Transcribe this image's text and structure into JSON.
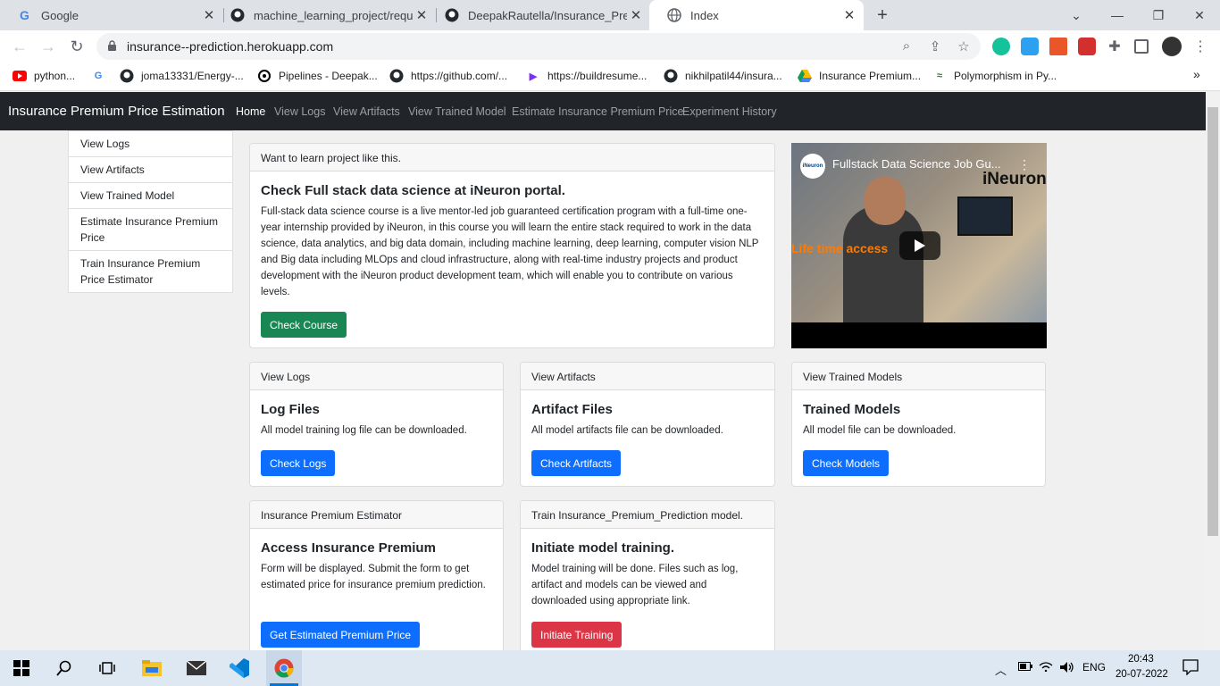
{
  "browser": {
    "tabs": [
      {
        "title": "Google",
        "icon": "google-g-icon",
        "active": false
      },
      {
        "title": "machine_learning_project/requir…",
        "icon": "github-icon",
        "active": false
      },
      {
        "title": "DeepakRautella/Insurance_Prem…",
        "icon": "github-icon",
        "active": false
      },
      {
        "title": "Index",
        "icon": "globe-icon",
        "active": true
      }
    ],
    "url": "insurance--prediction.herokuapp.com",
    "bookmarks": [
      {
        "label": "python...",
        "icon": "youtube-icon"
      },
      {
        "label": "",
        "icon": "google-g-icon"
      },
      {
        "label": "joma13331/Energy-...",
        "icon": "github-icon"
      },
      {
        "label": "Pipelines - Deepak...",
        "icon": "pipelines-icon"
      },
      {
        "label": "https://github.com/...",
        "icon": "github-icon"
      },
      {
        "label": "https://buildresume...",
        "icon": "play-icon"
      },
      {
        "label": "nikhilpatil44/insura...",
        "icon": "github-icon"
      },
      {
        "label": "Insurance Premium...",
        "icon": "drive-icon"
      },
      {
        "label": "Polymorphism in Py...",
        "icon": "code-icon"
      }
    ]
  },
  "navbar": {
    "brand": "Insurance Premium Price Estimation",
    "links": [
      "Home",
      "View Logs",
      "View Artifacts",
      "View Trained Model",
      "Estimate Insurance Premium Price",
      "Experiment History"
    ]
  },
  "sidebar": {
    "items": [
      "View Logs",
      "View Artifacts",
      "View Trained Model",
      "Estimate Insurance Premium Price",
      "Train Insurance Premium Price Estimator"
    ]
  },
  "promo": {
    "header": "Want to learn project like this.",
    "title": "Check Full stack data science at iNeuron portal.",
    "text": "Full-stack data science course is a live mentor-led job guaranteed certification program with a full-time one-year internship provided by iNeuron, in this course you will learn the entire stack required to work in the data science, data analytics, and big data domain, including machine learning, deep learning, computer vision NLP and Big data including MLOps and cloud infrastructure, along with real-time industry projects and product development with the iNeuron product development team, which will enable you to contribute on various levels.",
    "button": "Check Course"
  },
  "video": {
    "title": "Fullstack Data Science Job Gu...",
    "channel_badge": "iNeuron",
    "watermark": "iNeuron",
    "overlay_text": "Life time access"
  },
  "cards": [
    {
      "header": "View Logs",
      "title": "Log Files",
      "text": "All model training log file can be downloaded.",
      "button": "Check Logs"
    },
    {
      "header": "View Artifacts",
      "title": "Artifact Files",
      "text": "All model artifacts file can be downloaded.",
      "button": "Check Artifacts"
    },
    {
      "header": "View Trained Models",
      "title": "Trained Models",
      "text": "All model file can be downloaded.",
      "button": "Check Models"
    },
    {
      "header": "Insurance Premium Estimator",
      "title": "Access Insurance Premium",
      "text": "Form will be displayed. Submit the form to get estimated price for insurance premium prediction.",
      "button": "Get Estimated Premium Price"
    },
    {
      "header": "Train Insurance_Premium_Prediction model.",
      "title": "Initiate model training.",
      "text": "Model training will be done. Files such as log, artifact and models can be viewed and downloaded using appropriate link.",
      "button": "Initiate Training"
    }
  ],
  "colors": {
    "navbar": "#212529",
    "btn_success": "#198754",
    "btn_primary": "#0d6efd",
    "btn_danger": "#dc3545"
  },
  "taskbar": {
    "lang": "ENG",
    "time": "20:43",
    "date": "20-07-2022"
  }
}
